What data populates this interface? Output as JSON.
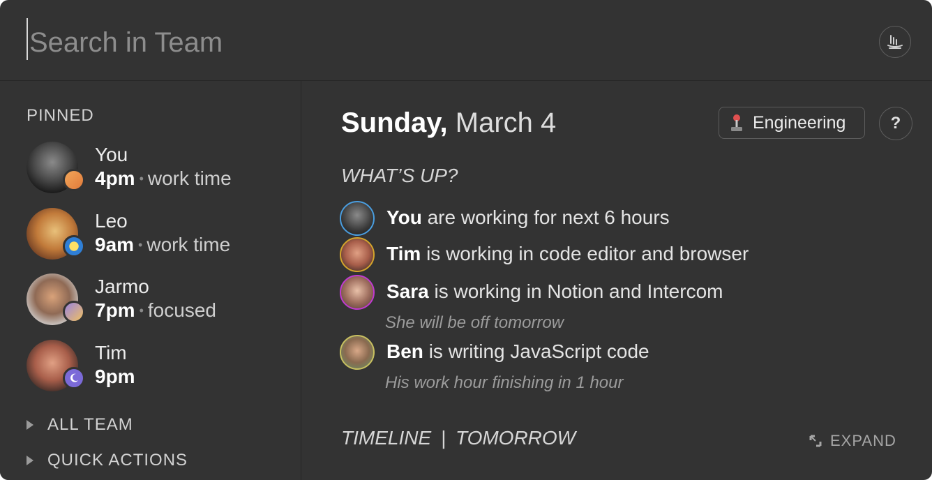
{
  "search": {
    "placeholder": "Search in Team"
  },
  "sidebar": {
    "pinned_label": "PINNED",
    "people": [
      {
        "name": "You",
        "time": "4pm",
        "status": "work time",
        "badge": "sunset-icon"
      },
      {
        "name": "Leo",
        "time": "9am",
        "status": "work time",
        "badge": "sun-icon"
      },
      {
        "name": "Jarmo",
        "time": "7pm",
        "status": "focused",
        "badge": "dusk-icon"
      },
      {
        "name": "Tim",
        "time": "9pm",
        "status": "",
        "badge": "moon-icon"
      }
    ],
    "groups": [
      {
        "label": "ALL TEAM"
      },
      {
        "label": "QUICK ACTIONS"
      }
    ]
  },
  "main": {
    "date": {
      "day": "Sunday,",
      "month_day": "March 4"
    },
    "team_button": "Engineering",
    "help": "?",
    "whats_up": "WHAT’S UP?",
    "activities": [
      {
        "name": "You",
        "text": "are working for next 6 hours",
        "sub": ""
      },
      {
        "name": "Tim",
        "text": "is working in code editor and browser",
        "sub": ""
      },
      {
        "name": "Sara",
        "text": "is working in Notion and Intercom",
        "sub": "She will be off tomorrow"
      },
      {
        "name": "Ben",
        "text": "is writing JavaScript code",
        "sub": "His work hour finishing in 1 hour"
      }
    ],
    "timeline": "TIMELINE",
    "timeline_sep": "|",
    "tomorrow": "TOMORROW",
    "expand": "EXPAND"
  },
  "colors": {
    "window_bg": "#333333",
    "activity_ring_you": "#4a9ee0",
    "activity_ring_tim": "#d4a52c",
    "activity_ring_sara": "#c03ad0",
    "activity_ring_ben": "#c8c060"
  }
}
